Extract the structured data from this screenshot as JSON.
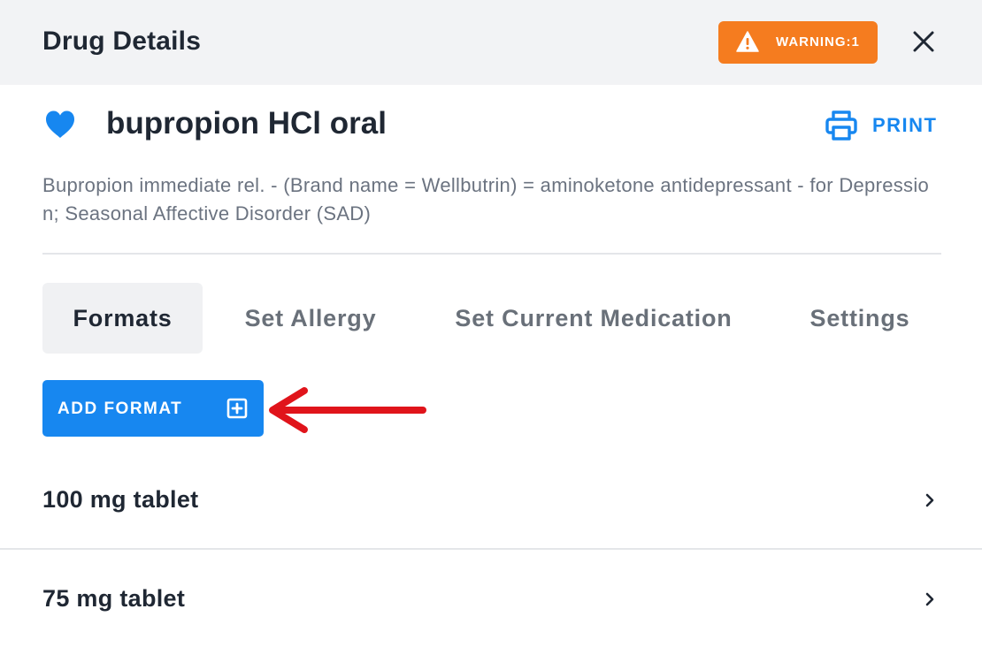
{
  "header": {
    "title": "Drug Details",
    "warning_label": "WARNING:1",
    "warning_icon": "warning-triangle-icon",
    "close_icon": "close-icon"
  },
  "drug": {
    "name": "bupropion HCl oral",
    "favorite_icon": "heart-icon",
    "description": "Bupropion immediate rel. - (Brand name = Wellbutrin) = aminoketone antidepressant - for Depression; Seasonal Affective Disorder (SAD)"
  },
  "print": {
    "label": "PRINT",
    "icon": "printer-icon"
  },
  "tabs": [
    {
      "label": "Formats",
      "active": true
    },
    {
      "label": "Set Allergy",
      "active": false
    },
    {
      "label": "Set Current Medication",
      "active": false
    },
    {
      "label": "Settings",
      "active": false
    }
  ],
  "add_format": {
    "label": "ADD FORMAT",
    "icon": "plus-square-icon"
  },
  "formats": [
    {
      "label": "100 mg tablet"
    },
    {
      "label": "75 mg tablet"
    }
  ],
  "colors": {
    "accent": "#1787f0",
    "warning": "#f57c1f",
    "annotation_arrow": "#e0141b"
  }
}
